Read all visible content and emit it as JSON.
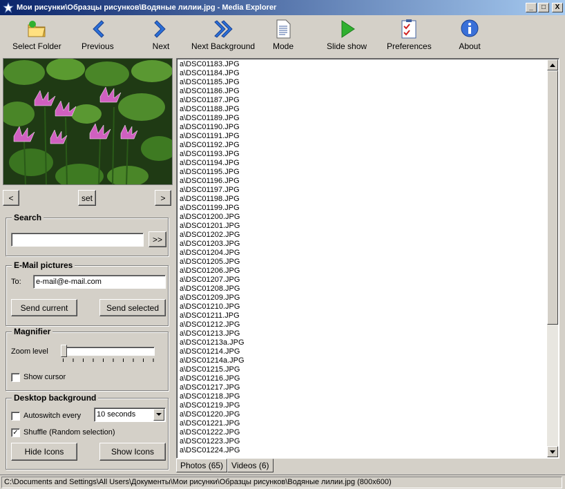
{
  "window": {
    "title": "Мои рисунки\\Образцы рисунков\\Водяные лилии.jpg - Media Explorer",
    "min": "_",
    "max": "□",
    "close": "X"
  },
  "toolbar": [
    {
      "id": "select-folder",
      "label": "Select Folder",
      "icon": "folder-icon"
    },
    {
      "id": "previous",
      "label": "Previous",
      "icon": "arrow-left-icon"
    },
    {
      "id": "next",
      "label": "Next",
      "icon": "arrow-right-icon"
    },
    {
      "id": "next-background",
      "label": "Next Background",
      "icon": "double-arrow-right-icon"
    },
    {
      "id": "mode",
      "label": "Mode",
      "icon": "document-icon"
    },
    {
      "id": "slide-show",
      "label": "Slide show",
      "icon": "play-icon"
    },
    {
      "id": "preferences",
      "label": "Preferences",
      "icon": "checklist-icon"
    },
    {
      "id": "about",
      "label": "About",
      "icon": "info-icon"
    }
  ],
  "preview_nav": {
    "prev": "<",
    "set": "set",
    "next": ">"
  },
  "search": {
    "title": "Search",
    "value": "",
    "go": ">>"
  },
  "email": {
    "title": "E-Mail pictures",
    "to_label": "To:",
    "to_value": "e-mail@e-mail.com",
    "send_current": "Send current",
    "send_selected": "Send selected"
  },
  "magnifier": {
    "title": "Magnifier",
    "zoom_label": "Zoom level",
    "zoom_value": 0,
    "show_cursor": "Show cursor",
    "show_cursor_checked": false
  },
  "desktop": {
    "title": "Desktop background",
    "autoswitch": "Autoswitch every",
    "autoswitch_checked": false,
    "interval": "10 seconds",
    "shuffle": "Shuffle (Random selection)",
    "shuffle_checked": true,
    "hide_icons": "Hide Icons",
    "show_icons": "Show Icons"
  },
  "files": [
    "a\\DSC01183.JPG",
    "a\\DSC01184.JPG",
    "a\\DSC01185.JPG",
    "a\\DSC01186.JPG",
    "a\\DSC01187.JPG",
    "a\\DSC01188.JPG",
    "a\\DSC01189.JPG",
    "a\\DSC01190.JPG",
    "a\\DSC01191.JPG",
    "a\\DSC01192.JPG",
    "a\\DSC01193.JPG",
    "a\\DSC01194.JPG",
    "a\\DSC01195.JPG",
    "a\\DSC01196.JPG",
    "a\\DSC01197.JPG",
    "a\\DSC01198.JPG",
    "a\\DSC01199.JPG",
    "a\\DSC01200.JPG",
    "a\\DSC01201.JPG",
    "a\\DSC01202.JPG",
    "a\\DSC01203.JPG",
    "a\\DSC01204.JPG",
    "a\\DSC01205.JPG",
    "a\\DSC01206.JPG",
    "a\\DSC01207.JPG",
    "a\\DSC01208.JPG",
    "a\\DSC01209.JPG",
    "a\\DSC01210.JPG",
    "a\\DSC01211.JPG",
    "a\\DSC01212.JPG",
    "a\\DSC01213.JPG",
    "a\\DSC01213a.JPG",
    "a\\DSC01214.JPG",
    "a\\DSC01214a.JPG",
    "a\\DSC01215.JPG",
    "a\\DSC01216.JPG",
    "a\\DSC01217.JPG",
    "a\\DSC01218.JPG",
    "a\\DSC01219.JPG",
    "a\\DSC01220.JPG",
    "a\\DSC01221.JPG",
    "a\\DSC01222.JPG",
    "a\\DSC01223.JPG",
    "a\\DSC01224.JPG"
  ],
  "tabs": [
    {
      "label": "Photos (65)",
      "active": false
    },
    {
      "label": "Videos (6)",
      "active": true
    }
  ],
  "status": "C:\\Documents and Settings\\All Users\\Документы\\Мои рисунки\\Образцы рисунков\\Водяные лилии.jpg   (800x600)"
}
